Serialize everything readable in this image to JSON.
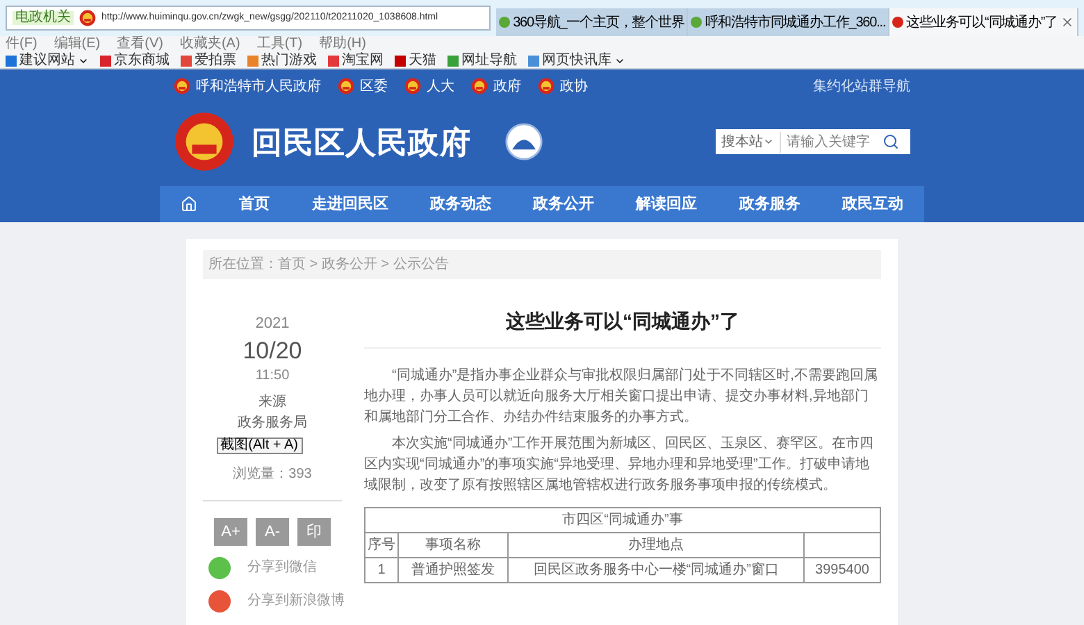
{
  "browser": {
    "address_badge": "电政机关",
    "url": "http://www.huiminqu.gov.cn/zwgk_new/gsgg/202110/t20211020_1038608.html",
    "tabs": [
      {
        "label": "360导航_一个主页，整个世界",
        "selected": false
      },
      {
        "label": "呼和浩特市同城通办工作_360...",
        "selected": false
      },
      {
        "label": "这些业务可以“同城通办”了",
        "selected": true
      }
    ],
    "menu": [
      "件(F)",
      "编辑(E)",
      "查看(V)",
      "收藏夹(A)",
      "工具(T)",
      "帮助(H)"
    ],
    "bookmarks": [
      {
        "label": "建议网站",
        "color": "#1e73d8",
        "dropdown": true
      },
      {
        "label": "京东商城",
        "color": "#d9242b",
        "dropdown": false
      },
      {
        "label": "爱拍票",
        "color": "#e2463c",
        "dropdown": false
      },
      {
        "label": "热门游戏",
        "color": "#e8832a",
        "dropdown": false
      },
      {
        "label": "淘宝网",
        "color": "#e4393c",
        "dropdown": false
      },
      {
        "label": "天猫",
        "color": "#c40000",
        "dropdown": false
      },
      {
        "label": "网址导航",
        "color": "#3aa13a",
        "dropdown": false
      },
      {
        "label": "网页快讯库",
        "color": "#4a90d9",
        "dropdown": true
      }
    ]
  },
  "site": {
    "top_links": [
      "呼和浩特市人民政府",
      "区委",
      "人大",
      "政府",
      "政协"
    ],
    "site_nav": "集约化站群导航",
    "title": "回民区人民政府",
    "search": {
      "scope": "搜本站",
      "placeholder": "请输入关键字"
    },
    "nav": [
      "首页",
      "走进回民区",
      "政务动态",
      "政务公开",
      "解读回应",
      "政务服务",
      "政民互动"
    ]
  },
  "article": {
    "breadcrumb": "所在位置：首页 > 政务公开 > 公示公告",
    "year": "2021",
    "date": "10/20",
    "time": "11:50",
    "source_label": "来源",
    "source": "政务服务局",
    "views": "浏览量：393",
    "tooltip": "截图(Alt + A)",
    "tools": [
      "A+",
      "A-",
      "印"
    ],
    "share": [
      {
        "kind": "wechat",
        "label": "分享到微信"
      },
      {
        "kind": "weibo",
        "label": "分享到新浪微博"
      }
    ],
    "title": "这些业务可以“同城通办”了",
    "paragraphs": [
      "“同城通办”是指办事企业群众与审批权限归属部门处于不同辖区时,不需要跑回属地办理，办事人员可以就近向服务大厅相关窗口提出申请、提交办事材料,异地部门和属地部门分工合作、办结办件结束服务的办事方式。",
      "本次实施“同城通办”工作开展范围为新城区、回民区、玉泉区、赛罕区。在市四区内实现“同城通办”的事项实施“异地受理、异地办理和异地受理”工作。打破申请地域限制，改变了原有按照辖区属地管辖权进行政务服务事项申报的传统模式。"
    ],
    "table": {
      "caption": "市四区“同城通办”事",
      "columns": [
        "序号",
        "事项名称",
        "办理地点",
        ""
      ],
      "rows": [
        [
          "1",
          "普通护照签发",
          "回民区政务服务中心一楼“同城通办”窗口",
          "3995400"
        ]
      ]
    }
  }
}
